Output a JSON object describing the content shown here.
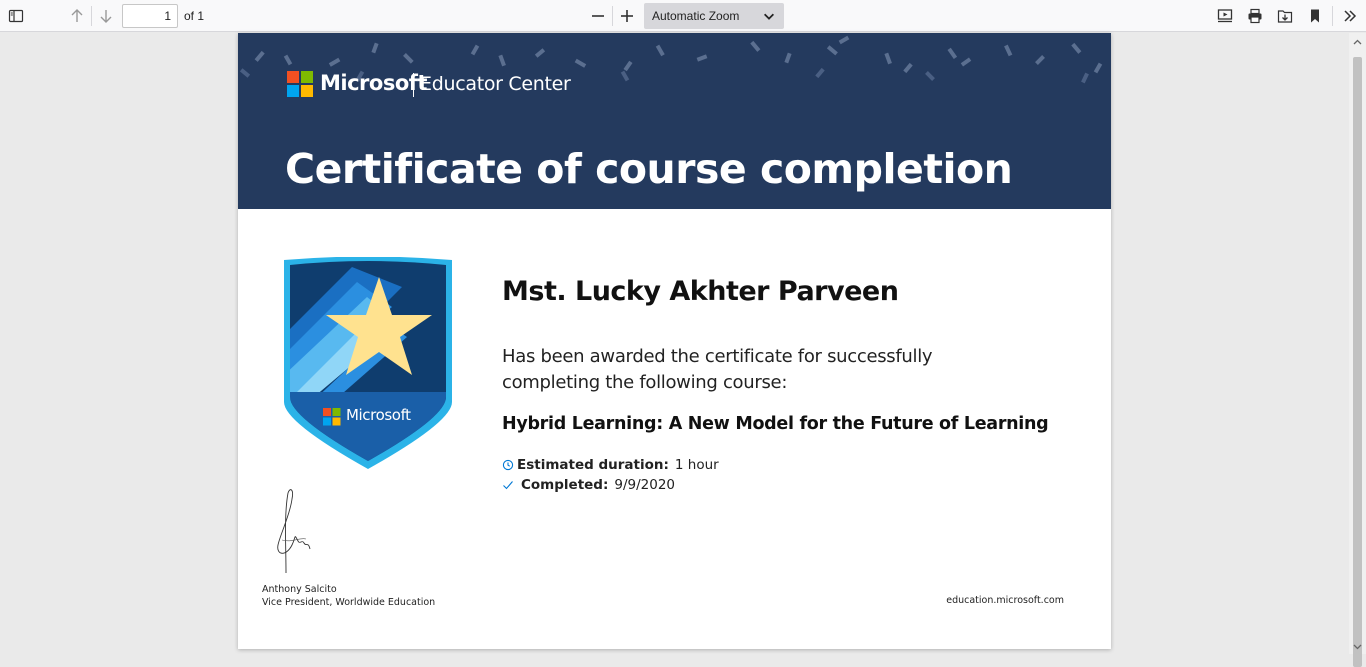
{
  "toolbar": {
    "page_number": "1",
    "page_of": "of 1",
    "zoom": "Automatic Zoom",
    "icons": [
      "sidebar-toggle-icon",
      "arrow-up-icon",
      "arrow-down-icon",
      "zoom-out-icon",
      "zoom-in-icon",
      "presentation-icon",
      "print-icon",
      "save-icon",
      "bookmark-icon",
      "tools-chevron-icon"
    ]
  },
  "certificate": {
    "brand_name": "Microsoft",
    "brand_product": "Educator Center",
    "title": "Certificate of course completion",
    "badge_brand": "Microsoft",
    "recipient": "Mst. Lucky Akhter Parveen",
    "awarded_text": "Has been awarded the certificate for successfully completing the following course:",
    "course": "Hybrid Learning: A New Model for the Future of Learning",
    "duration_label": "Estimated duration:",
    "duration_value": "1 hour",
    "completed_label": "Completed:",
    "completed_value": "9/9/2020",
    "signer_name": "Anthony Salcito",
    "signer_title": "Vice President, Worldwide Education",
    "website": "education.microsoft.com"
  },
  "colors": {
    "banner": "#243a5e",
    "ms_red": "#f25022",
    "ms_green": "#7fba00",
    "ms_blue": "#00a4ef",
    "ms_yellow": "#ffb900",
    "badge_outer": "#2bb3e8",
    "badge_inner": "#0f3d6e",
    "star": "#ffe28f"
  }
}
